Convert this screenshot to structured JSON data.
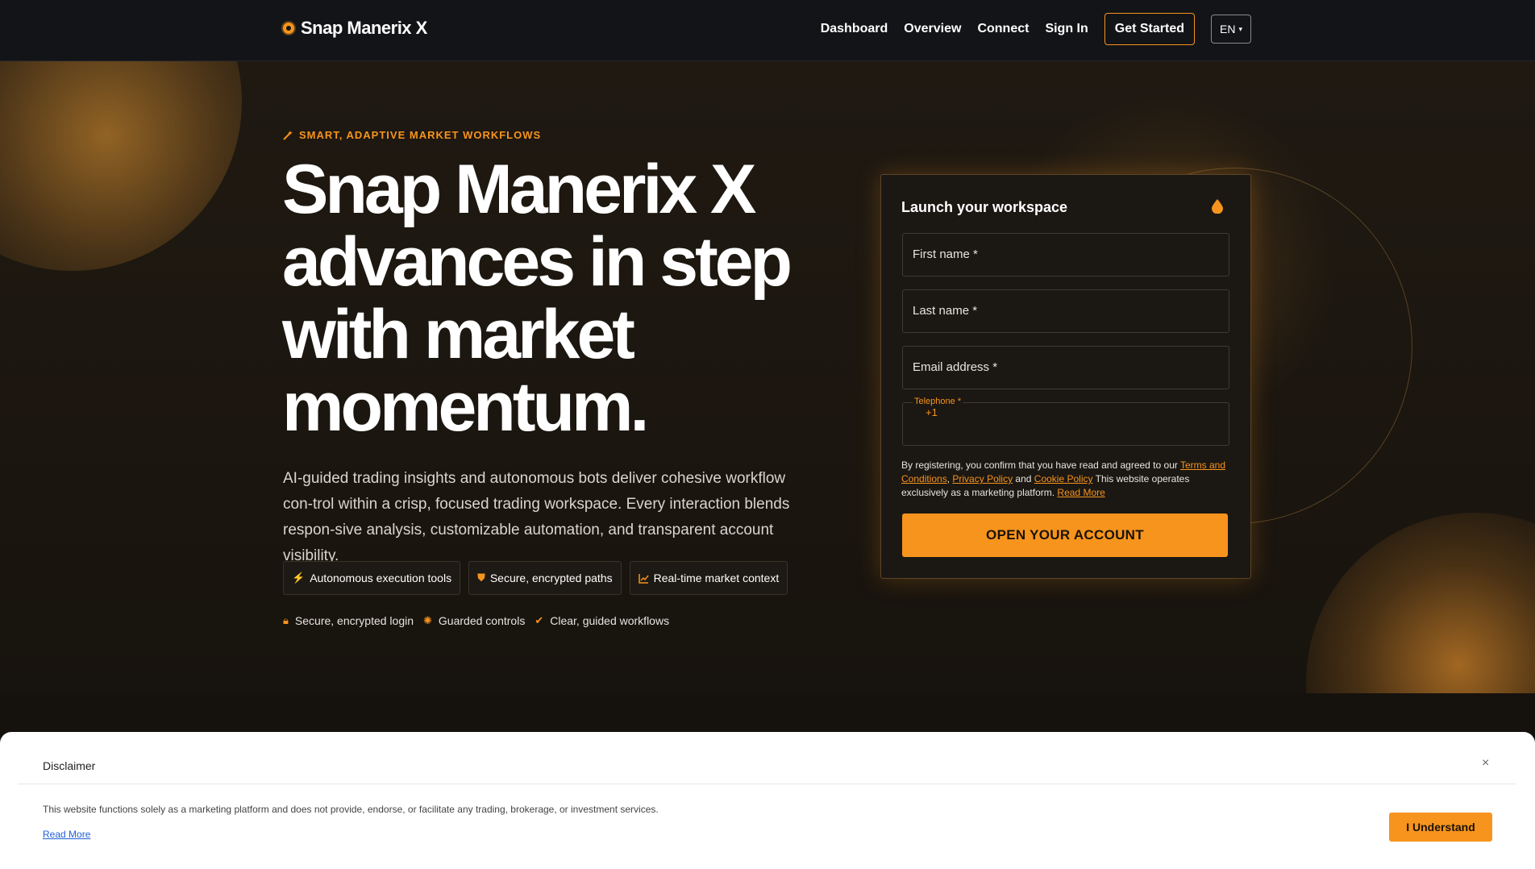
{
  "header": {
    "brand": "Snap Manerix X",
    "nav": [
      "Dashboard",
      "Overview",
      "Connect",
      "Sign In"
    ],
    "cta": "Get Started",
    "lang": "EN"
  },
  "hero": {
    "eyebrow": "SMART, ADAPTIVE MARKET WORKFLOWS",
    "title": "Snap Manerix X advances in step with market momentum.",
    "description": "AI-guided trading insights and autonomous bots deliver cohesive workflow con-trol within a crisp, focused trading workspace. Every interaction blends respon-sive analysis, customizable automation, and transparent account visibility.",
    "chips": [
      "Autonomous execution tools",
      "Secure, encrypted paths",
      "Real-time market context"
    ],
    "trust": [
      "Secure, encrypted login",
      "Guarded controls",
      "Clear, guided workflows"
    ]
  },
  "form": {
    "title": "Launch your workspace",
    "first_name": "First name *",
    "last_name": "Last name *",
    "email": "Email address *",
    "telephone_label": "Telephone *",
    "telephone_code": "+1",
    "legal_prefix": "By registering, you confirm that you have read and agreed to our",
    "terms_link": "Terms and Conditions",
    "sep1": ",",
    "privacy_link": "Privacy Policy",
    "and": "and",
    "cookie_link": "Cookie Policy",
    "legal_suffix": "This website operates exclusively as a marketing platform.",
    "read_more": "Read More",
    "submit": "OPEN YOUR ACCOUNT"
  },
  "disclaimer": {
    "title": "Disclaimer",
    "close": "×",
    "text": "This website functions solely as a marketing platform and does not provide, endorse, or facilitate any trading, brokerage, or investment services.",
    "read_more": "Read More",
    "button": "I Understand"
  },
  "colors": {
    "accent": "#f7941d",
    "header_bg": "#131417",
    "hero_bg": "#1b160f"
  }
}
